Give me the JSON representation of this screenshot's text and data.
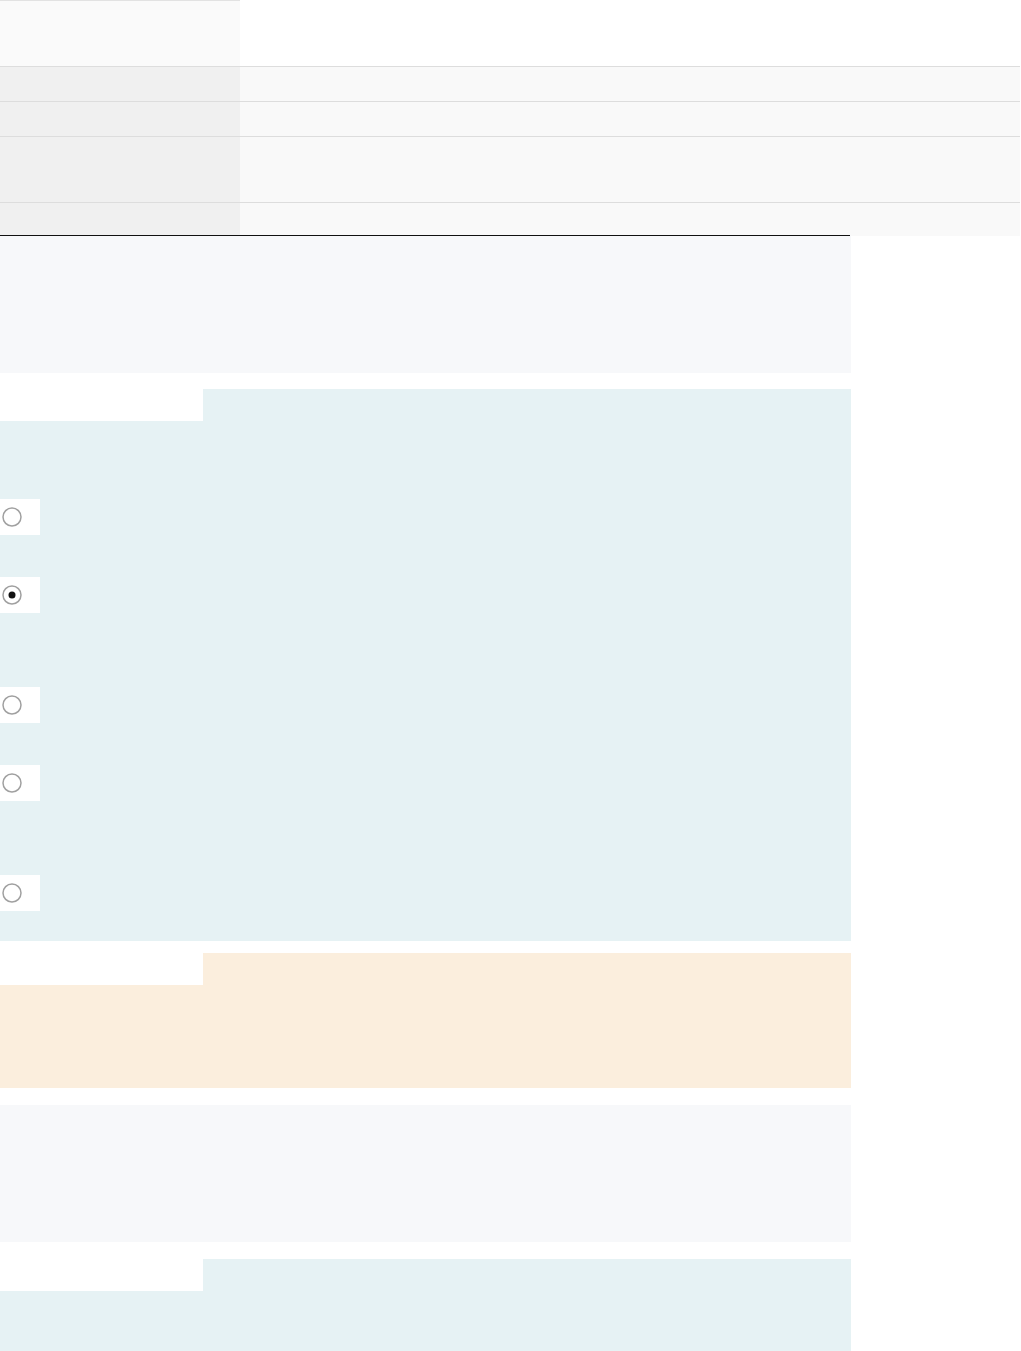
{
  "panels": [
    {
      "kind": "note"
    },
    {
      "kind": "question",
      "options": [
        {
          "selected": false
        },
        {
          "selected": true
        },
        {
          "selected": false
        },
        {
          "selected": false
        },
        {
          "selected": false
        }
      ]
    },
    {
      "kind": "warning"
    },
    {
      "kind": "note"
    },
    {
      "kind": "question"
    }
  ]
}
